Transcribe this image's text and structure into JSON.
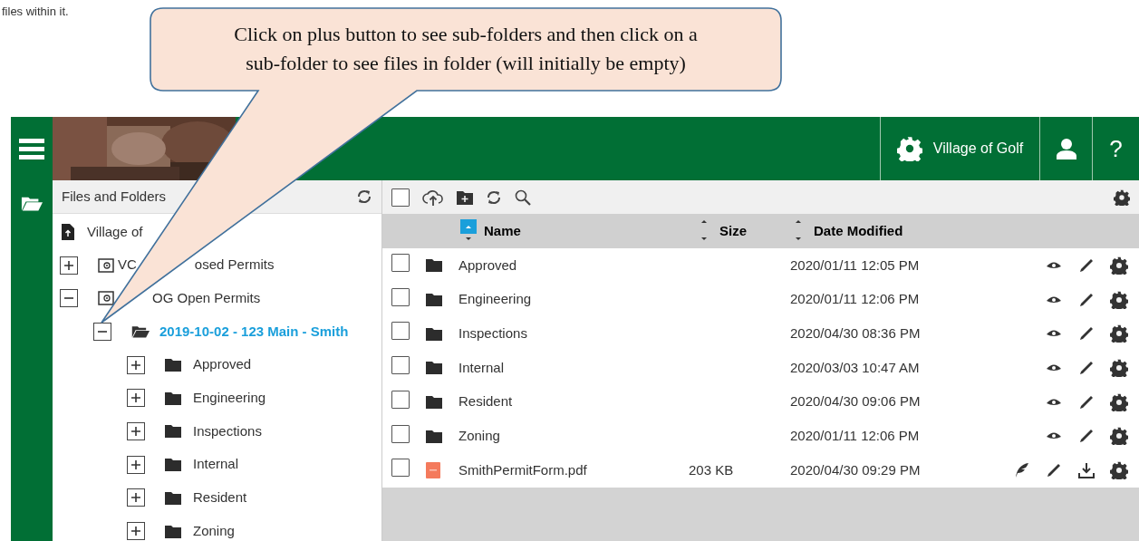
{
  "document_text": "files within it.",
  "callout": {
    "text": "Click on plus button to see sub-folders and then click on a sub-folder to see files in folder (will initially be empty)"
  },
  "header": {
    "site": "Village of Golf",
    "help": "?"
  },
  "left_panel": {
    "title": "Files and Folders",
    "tree": [
      {
        "kind": "root",
        "parts": [
          "Village of"
        ],
        "children": [
          {
            "kind": "drive",
            "parts": [
              "VC",
              "osed Permits"
            ],
            "expanded": false,
            "selected": false
          },
          {
            "kind": "drive",
            "parts": [
              "OG Open Permits"
            ],
            "covered_start": true,
            "expanded": true,
            "selected": false,
            "children": [
              {
                "kind": "folder",
                "parts": [
                  "2019-10-02 - 123 Main - Smith"
                ],
                "expanded": true,
                "selected": true,
                "children": [
                  {
                    "kind": "folder",
                    "parts": [
                      "Approved"
                    ],
                    "expanded": false,
                    "selected": false
                  },
                  {
                    "kind": "folder",
                    "parts": [
                      "Engineering"
                    ],
                    "expanded": false,
                    "selected": false
                  },
                  {
                    "kind": "folder",
                    "parts": [
                      "Inspections"
                    ],
                    "expanded": false,
                    "selected": false
                  },
                  {
                    "kind": "folder",
                    "parts": [
                      "Internal"
                    ],
                    "expanded": false,
                    "selected": false
                  },
                  {
                    "kind": "folder",
                    "parts": [
                      "Resident"
                    ],
                    "expanded": false,
                    "selected": false
                  },
                  {
                    "kind": "folder",
                    "parts": [
                      "Zoning"
                    ],
                    "expanded": false,
                    "selected": false
                  }
                ]
              }
            ]
          }
        ]
      }
    ]
  },
  "toolbar": {
    "select_all": {
      "checked": false
    }
  },
  "table": {
    "columns": [
      {
        "label": "Name",
        "sorted": true
      },
      {
        "label": "Size",
        "sorted": false
      },
      {
        "label": "Date Modified",
        "sorted": false
      }
    ],
    "rows": [
      {
        "kind": "folder",
        "name": "Approved",
        "date": "2020/01/11 12:05 PM",
        "checked": false
      },
      {
        "kind": "folder",
        "name": "Engineering",
        "date": "2020/01/11 12:06 PM",
        "checked": false
      },
      {
        "kind": "folder",
        "name": "Inspections",
        "date": "2020/04/30 08:36 PM",
        "checked": false
      },
      {
        "kind": "folder",
        "name": "Internal",
        "date": "2020/03/03 10:47 AM",
        "checked": false
      },
      {
        "kind": "folder",
        "name": "Resident",
        "date": "2020/04/30 09:06 PM",
        "checked": false
      },
      {
        "kind": "folder",
        "name": "Zoning",
        "date": "2020/01/11 12:06 PM",
        "checked": false
      },
      {
        "kind": "pdf",
        "name": "SmithPermitForm.pdf",
        "size": "203 KB",
        "date": "2020/04/30 09:29 PM",
        "checked": false
      }
    ]
  }
}
